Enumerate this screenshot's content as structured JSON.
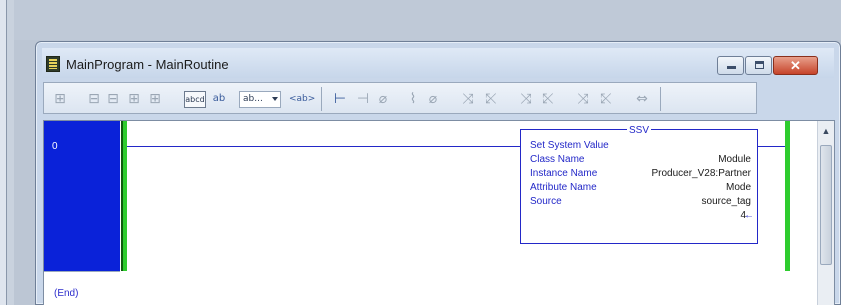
{
  "window": {
    "title": "MainProgram - MainRoutine",
    "controls": {
      "minimize": "",
      "maximize": "",
      "close": "✕"
    }
  },
  "toolbar": {
    "text_box_label": "abcd",
    "small_label": "ab\ncd",
    "dropdown_value": "ab...",
    "tag_button_label": "<ab>"
  },
  "ladder": {
    "rung_number": "0",
    "end_label": "(End)",
    "instruction": {
      "mnemonic": "SSV",
      "description": "Set System Value",
      "params": [
        {
          "name": "Class Name",
          "value": "Module"
        },
        {
          "name": "Instance Name",
          "value": "Producer_V28:Partner"
        },
        {
          "name": "Attribute Name",
          "value": "Mode"
        },
        {
          "name": "Source",
          "value": "source_tag"
        }
      ],
      "source_value": "4"
    }
  },
  "colors": {
    "rung_margin": "#0a22d9",
    "power_rail": "#2ecc2e",
    "wire": "#2328c8"
  }
}
